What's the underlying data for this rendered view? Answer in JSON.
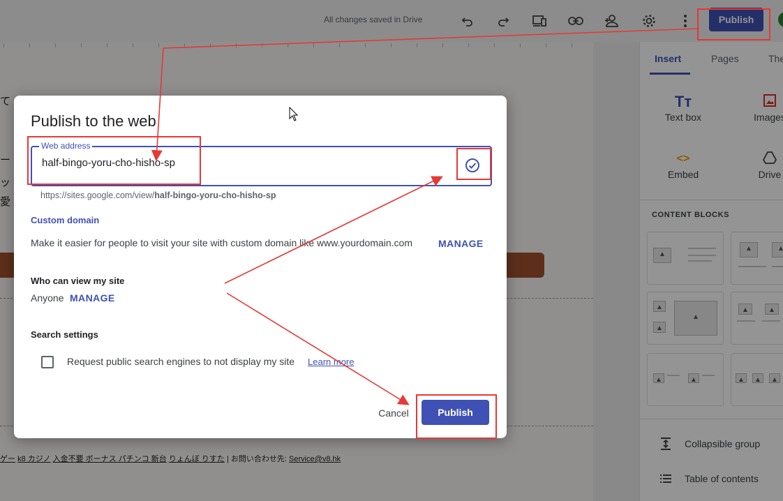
{
  "topbar": {
    "status": "All changes saved in Drive",
    "icons": [
      "undo-icon",
      "redo-icon",
      "preview-device-icon",
      "link-icon",
      "share-person-add-icon",
      "settings-gear-icon",
      "more-vert-icon"
    ],
    "publish_label": "Publish"
  },
  "right_panel": {
    "tabs": [
      {
        "label": "Insert"
      },
      {
        "label": "Pages"
      },
      {
        "label": "The"
      }
    ],
    "insert_items": [
      {
        "label": "Text box",
        "icon": "text-box-icon"
      },
      {
        "label": "Images",
        "icon": "image-icon"
      },
      {
        "label": "Embed",
        "icon": "embed-code-icon"
      },
      {
        "label": "Drive",
        "icon": "drive-icon"
      }
    ],
    "content_blocks_title": "CONTENT BLOCKS",
    "side_items": [
      {
        "label": "Collapsible group",
        "icon": "collapsible-group-icon"
      },
      {
        "label": "Table of contents",
        "icon": "table-of-contents-icon"
      }
    ]
  },
  "canvas": {
    "jp_fragments": [
      "て",
      "ー",
      "ッ",
      "愛"
    ],
    "footer": [
      "ゲー",
      "k8 カジノ",
      "入金不要 ボーナス パチンコ 新台",
      "りょんぼ りすた",
      "| お問い合わせ先:",
      "Service@v8.hk"
    ]
  },
  "dialog": {
    "title": "Publish to the web",
    "web_address_label": "Web address",
    "web_address_value": "half-bingo-yoru-cho-hisho-sp",
    "url_prefix": "https://sites.google.com/view/",
    "url_slug": "half-bingo-yoru-cho-hisho-sp",
    "custom_domain_heading": "Custom domain",
    "custom_domain_text": "Make it easier for people to visit your site with custom domain like www.yourdomain.com",
    "manage_label": "MANAGE",
    "who_can_view_heading": "Who can view my site",
    "viewers": "Anyone",
    "viewers_manage_label": "MANAGE",
    "search_settings_heading": "Search settings",
    "search_checkbox_label": "Request public search engines to not display my site",
    "search_checkbox_checked": false,
    "learn_more": "Learn more",
    "cancel_label": "Cancel",
    "publish_label": "Publish"
  },
  "colors": {
    "accent": "#3f51b5",
    "annotation": "#e53935"
  }
}
